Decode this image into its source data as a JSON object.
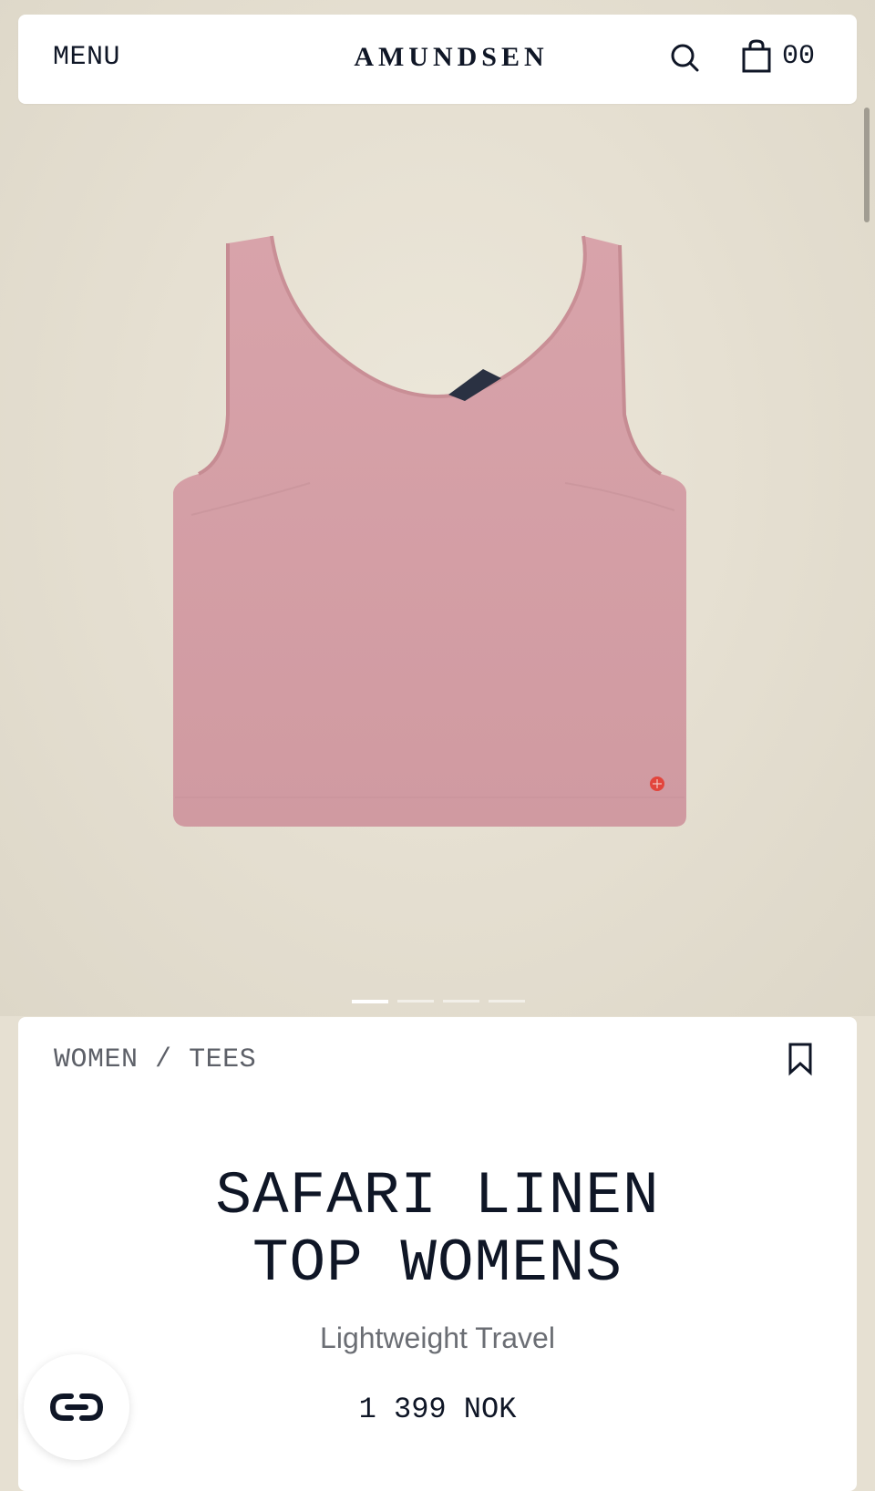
{
  "header": {
    "menu_label": "MENU",
    "logo_text": "AMUNDSEN",
    "cart_count": "00"
  },
  "gallery": {
    "slide_count": 4,
    "active_slide": 1
  },
  "product": {
    "breadcrumb": [
      "WOMEN",
      "TEES"
    ],
    "breadcrumb_separator": "/",
    "title_line1": "SAFARI LINEN",
    "title_line2": "TOP WOMENS",
    "subtitle": "Lightweight Travel",
    "price": "1 399 NOK",
    "garment_color": "#d59ea5"
  },
  "icons": {
    "search": "search-icon",
    "cart": "shopping-bag-icon",
    "bookmark": "bookmark-icon",
    "chat": "chat-logo-icon"
  }
}
